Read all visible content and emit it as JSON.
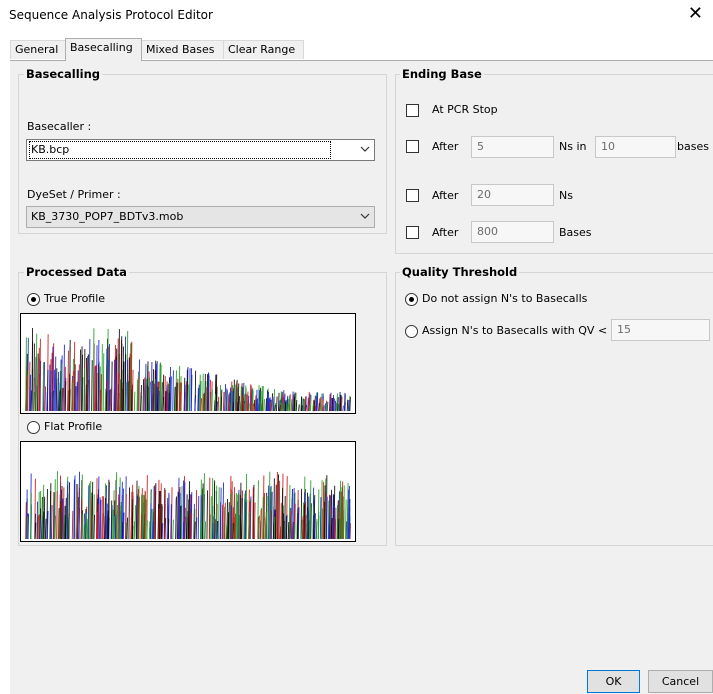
{
  "window": {
    "title": "Sequence Analysis Protocol Editor",
    "close_glyph": "✕"
  },
  "tabs": [
    {
      "label": "General",
      "active": false
    },
    {
      "label": "Basecalling",
      "active": true
    },
    {
      "label": "Mixed Bases",
      "active": false
    },
    {
      "label": "Clear Range",
      "active": false
    }
  ],
  "basecalling": {
    "title": "Basecalling",
    "basecaller_label": "Basecaller :",
    "basecaller_value": "KB.bcp",
    "dyeset_label": "DyeSet / Primer :",
    "dyeset_value": "KB_3730_POP7_BDTv3.mob"
  },
  "ending_base": {
    "title": "Ending Base",
    "at_pcr_stop": {
      "label": "At PCR Stop",
      "checked": false
    },
    "after_ns_in": {
      "label": "After",
      "count": "5",
      "mid_label": "Ns in",
      "window": "10",
      "suffix": "bases",
      "checked": false
    },
    "after_ns": {
      "label": "After",
      "count": "20",
      "suffix": "Ns",
      "checked": false
    },
    "after_bases": {
      "label": "After",
      "count": "800",
      "suffix": "Bases",
      "checked": false
    }
  },
  "processed_data": {
    "title": "Processed Data",
    "true_profile_label": "True Profile",
    "flat_profile_label": "Flat Profile",
    "selected": "true_profile"
  },
  "quality_threshold": {
    "title": "Quality Threshold",
    "option_no_assign": "Do not assign N's to Basecalls",
    "option_assign": "Assign N's to Basecalls with QV <",
    "qv_value": "15",
    "selected": "no_assign"
  },
  "buttons": {
    "ok": "OK",
    "cancel": "Cancel"
  },
  "colors": {
    "trace_red": "#cc1f1f",
    "trace_blue": "#1f2bd6",
    "trace_green": "#2aa02a",
    "trace_black": "#111111",
    "focus_blue": "#0078d7"
  }
}
